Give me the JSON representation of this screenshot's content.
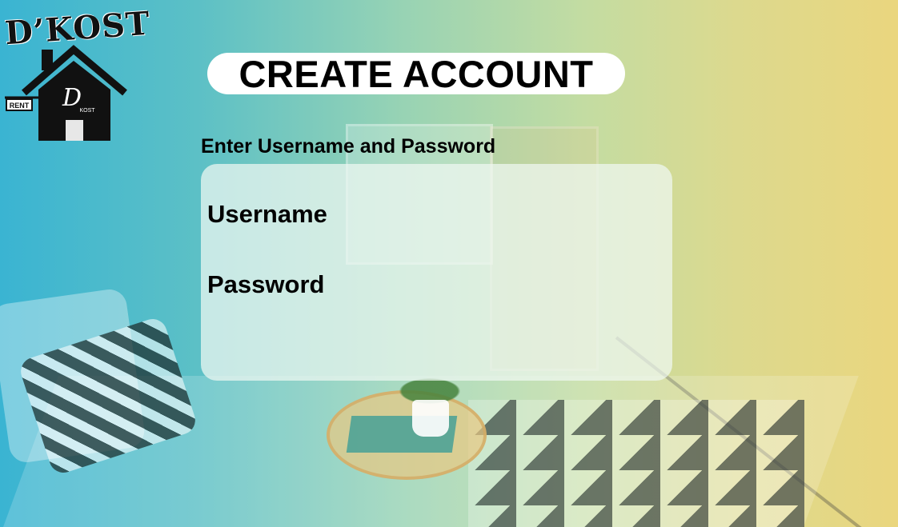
{
  "logo": {
    "wordmark": "D’KOST",
    "sign_text": "RENT",
    "house_letter": "D",
    "house_small_text": "KOST"
  },
  "header": {
    "title": "CREATE ACCOUNT"
  },
  "form": {
    "instruction": "Enter Username and Password",
    "username": {
      "label": "Username",
      "value": "",
      "placeholder": ""
    },
    "password": {
      "label": "Password",
      "value": "",
      "placeholder": ""
    }
  },
  "colors": {
    "gradient_left": "#3ab4d2",
    "gradient_mid": "#98d3b4",
    "gradient_right": "#ead67e",
    "panel": "#f0f8f2",
    "title_pill": "#ffffff"
  }
}
